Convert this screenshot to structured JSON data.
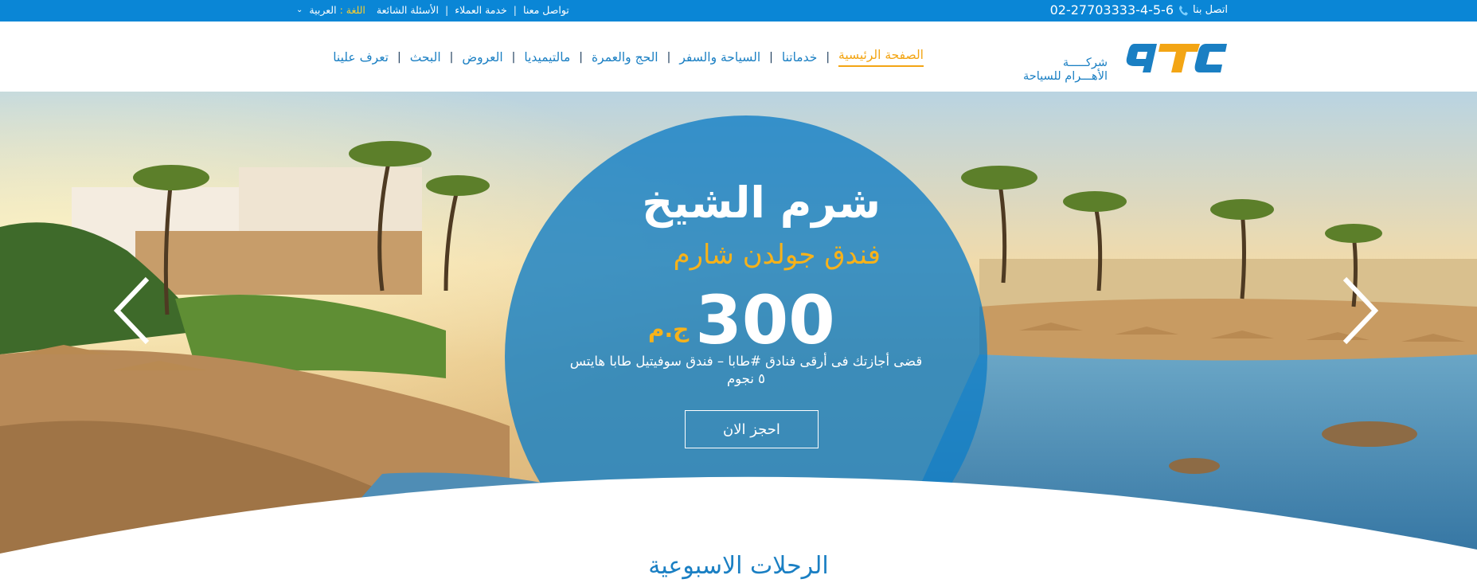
{
  "topbar": {
    "contact_label": "اتصل بنا",
    "phone": "02-27703333-4-5-6",
    "links": [
      "تواصل معنا",
      "خدمة العملاء",
      "الأسئلة الشائعة"
    ],
    "language_label": "اللغة :",
    "language_value": "العربية"
  },
  "logo": {
    "brand": "ATC",
    "line1": "شركـــــة",
    "line2": "الأهـــرام للسياحة"
  },
  "nav": {
    "items": [
      {
        "label": "الصفحة الرئيسية",
        "active": true
      },
      {
        "label": "خدماتنا",
        "active": false
      },
      {
        "label": "السياحة والسفر",
        "active": false
      },
      {
        "label": "الحج والعمرة",
        "active": false
      },
      {
        "label": "مالتيميديا",
        "active": false
      },
      {
        "label": "العروض",
        "active": false
      },
      {
        "label": "البحث",
        "active": false
      },
      {
        "label": "تعرف علينا",
        "active": false
      }
    ]
  },
  "hero": {
    "destination": "شرم الشيخ",
    "hotel": "فندق جولدن شارم",
    "price": "300",
    "currency": "ج.م",
    "description": "قضى أجازتك فى أرقى فنادق #طابا – فندق سوفيتيل طابا هايتس ٥ نجوم",
    "book_button": "احجز الان"
  },
  "sections": {
    "weekly_trips_title": "الرحلات الاسبوعية"
  },
  "colors": {
    "primary": "#0a86d6",
    "accent": "#f3a514",
    "nav_text": "#1a7fc3"
  },
  "icons": {
    "phone": "phone-icon",
    "lang_chevron": "chevron-down-icon",
    "prev": "chevron-left-icon",
    "next": "chevron-right-icon"
  }
}
